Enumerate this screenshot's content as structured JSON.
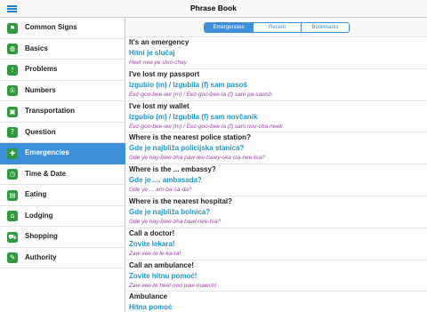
{
  "app": {
    "title": "Phrase Book"
  },
  "sidebar": {
    "items": [
      {
        "label": "Common Signs",
        "icon": "sign-icon",
        "glyph": "⚑",
        "active": false
      },
      {
        "label": "Basics",
        "icon": "globe-icon",
        "glyph": "◍",
        "active": false
      },
      {
        "label": "Problems",
        "icon": "warning-icon",
        "glyph": "!",
        "active": false
      },
      {
        "label": "Numbers",
        "icon": "numbers-icon",
        "glyph": "①",
        "active": false
      },
      {
        "label": "Transportation",
        "icon": "bus-icon",
        "glyph": "▣",
        "active": false
      },
      {
        "label": "Question",
        "icon": "question-icon",
        "glyph": "?",
        "active": false
      },
      {
        "label": "Emergencies",
        "icon": "emergency-icon",
        "glyph": "✚",
        "active": true
      },
      {
        "label": "Time & Date",
        "icon": "clock-icon",
        "glyph": "◷",
        "active": false
      },
      {
        "label": "Eating",
        "icon": "food-icon",
        "glyph": "▤",
        "active": false
      },
      {
        "label": "Lodging",
        "icon": "home-icon",
        "glyph": "⌂",
        "active": false
      },
      {
        "label": "Shopping",
        "icon": "cart-icon",
        "glyph": "⛟",
        "active": false
      },
      {
        "label": "Authority",
        "icon": "pen-icon",
        "glyph": "✎",
        "active": false
      }
    ]
  },
  "tabs": [
    {
      "label": "Emergencies",
      "active": true
    },
    {
      "label": "Recent",
      "active": false
    },
    {
      "label": "Bookmarks",
      "active": false
    }
  ],
  "phrases": [
    {
      "en": "It's an emergency",
      "tr": "Hitni je slučaj",
      "pr": "Heet-nee ye sloo-chay"
    },
    {
      "en": "I've lost my passport",
      "tr": "Izgubio (m) / Izgubila (f) sam pasoš",
      "pr": "Eez-goo-bee-aw (m) / Eez-goo-bee-la (f) sam pa-sawsh"
    },
    {
      "en": "I've lost my wallet",
      "tr": "Izgubio (m) / Izgubila (f) sam novčanik",
      "pr": "Eez-goo-bee-aw (m) / Eez-goo-bee-la (f) sam nov-cha-neek"
    },
    {
      "en": "Where is the nearest police station?",
      "tr": "Gde je najbliža policijska stanica?",
      "pr": "Gde ye nay-blee-zha paw-lee-tseey-ska sta-nee-tsa?"
    },
    {
      "en": "Where is the ... embassy?",
      "tr": "Gde je .... ambasada?",
      "pr": "Gde ye ... am-ba-sa-da?"
    },
    {
      "en": "Where is the nearest hospital?",
      "tr": "Gde je najbliža bolnica?",
      "pr": "Gde ye nay-blee-zha bawl-nee-tsa?"
    },
    {
      "en": "Call a doctor!",
      "tr": "Zovite lekara!",
      "pr": "Zaw-vee-te le-ka-ra!"
    },
    {
      "en": "Call an ambulance!",
      "tr": "Zovite hitnu pomoć!",
      "pr": "Zaw-vee-te heet-noo paw-mawch!"
    },
    {
      "en": "Ambulance",
      "tr": "Hitna pomoć",
      "pr": ""
    }
  ]
}
